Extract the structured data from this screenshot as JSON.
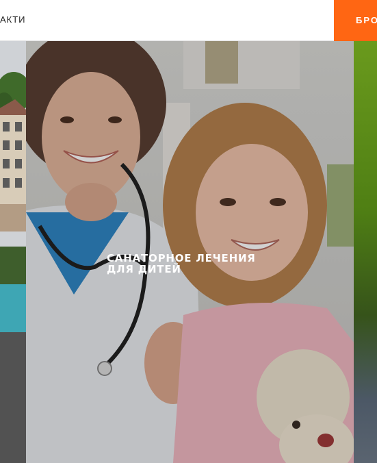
{
  "header": {
    "nav_contacts": "АКТИ",
    "book_button": "БРО"
  },
  "slides": {
    "main": {
      "title_line1": "САНАТОРНОЕ ЛЕЧЕНИЯ",
      "title_line2": "ДЛЯ ДИТЕЙ"
    }
  },
  "colors": {
    "accent": "#ff6613",
    "title_text": "#ffffff"
  }
}
